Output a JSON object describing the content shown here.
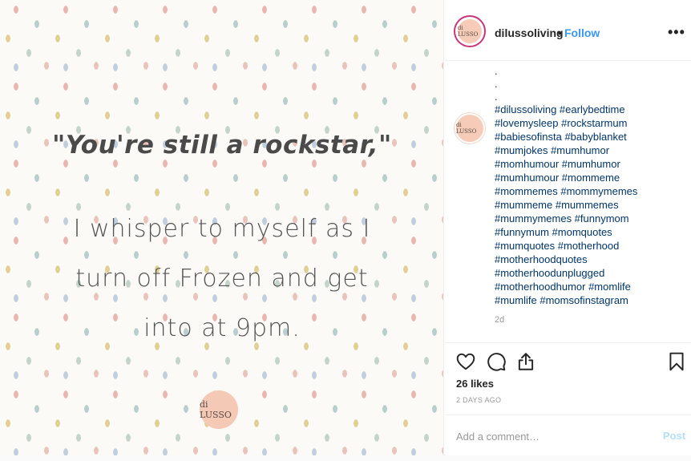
{
  "image": {
    "quote": "\"You're still a rockstar,\"",
    "lines": [
      "I whisper to myself as I",
      "turn off Frozen and get",
      "into at 9pm."
    ],
    "logo_text": "di LUSSO"
  },
  "header": {
    "avatar_text": "di LUSSO",
    "username": "dilussoliving",
    "separator": "•",
    "follow_label": "Follow",
    "more_label": "•••"
  },
  "caption": {
    "avatar_text": "di LUSSO",
    "dots": [
      ".",
      ".",
      "."
    ],
    "hashtags": [
      "#dilussoliving #earlybedtime",
      "#lovemysleep #rockstarmum",
      "#babiesofinsta #babyblanket",
      "#mumjokes #mumhumor",
      "#momhumour #mumhumor",
      "#mumhumour #mommeme",
      "#mommemes #mommymemes",
      "#mummeme #mummemes",
      "#mummymemes #funnymom",
      "#funnymum #momquotes",
      "#mumquotes #motherhood",
      "#motherhoodquotes",
      "#motherhoodunplugged",
      "#motherhoodhumor #momlife",
      "#mumlife #momsofinstagram"
    ],
    "age": "2d"
  },
  "actions": {
    "icons": [
      "heart-icon",
      "comment-icon",
      "share-icon",
      "bookmark-icon"
    ],
    "likes": "26 likes",
    "timestamp": "2 DAYS AGO"
  },
  "comment": {
    "placeholder": "Add a comment…",
    "post_label": "Post"
  },
  "colors": {
    "link": "#3897f0",
    "hashtag": "#003569",
    "post_disabled": "#b2dffc",
    "avatar_bg": "#f6cbb7",
    "story_ring": "#c7367a"
  }
}
